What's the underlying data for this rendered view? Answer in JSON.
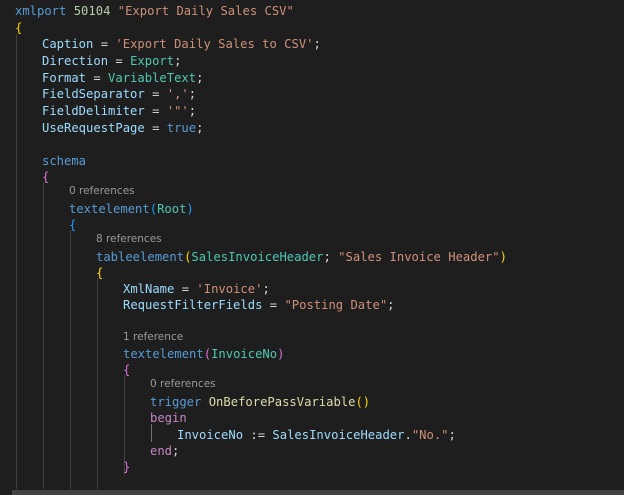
{
  "code": {
    "line_xmlport": {
      "keyword": "xmlport",
      "id": "50104",
      "name": "\"Export Daily Sales CSV\""
    },
    "open_brace_root": "{",
    "caption": {
      "prop": "Caption",
      "eq": " = ",
      "value": "'Export Daily Sales to CSV'",
      "end": ";"
    },
    "direction": {
      "prop": "Direction",
      "eq": " = ",
      "value": "Export",
      "end": ";"
    },
    "format": {
      "prop": "Format",
      "eq": " = ",
      "value": "VariableText",
      "end": ";"
    },
    "field_separator": {
      "prop": "FieldSeparator",
      "eq": " = ",
      "value": "','",
      "end": ";"
    },
    "field_delimiter": {
      "prop": "FieldDelimiter",
      "eq": " = ",
      "value": "'\"'",
      "end": ";"
    },
    "use_request_page": {
      "prop": "UseRequestPage",
      "eq": " = ",
      "value": "true",
      "end": ";"
    },
    "schema": {
      "keyword": "schema",
      "brace": "{"
    },
    "lens_root": "0 references",
    "textelement_root": {
      "keyword": "textelement",
      "open": "(",
      "name": "Root",
      "close": ")",
      "brace": "{"
    },
    "lens_table": "8 references",
    "tableelement": {
      "keyword": "tableelement",
      "open": "(",
      "name": "SalesInvoiceHeader",
      "sep": "; ",
      "table": "\"Sales Invoice Header\"",
      "close": ")",
      "brace": "{"
    },
    "xmlname": {
      "prop": "XmlName",
      "eq": " = ",
      "value": "'Invoice'",
      "end": ";"
    },
    "request_filter": {
      "prop": "RequestFilterFields",
      "eq": " = ",
      "value": "\"Posting Date\"",
      "end": ";"
    },
    "lens_invoice": "1 reference",
    "textelement_invoice": {
      "keyword": "textelement",
      "open": "(",
      "name": "InvoiceNo",
      "close": ")",
      "brace": "{"
    },
    "lens_trigger": "0 references",
    "trigger": {
      "keyword": "trigger",
      "name": "OnBeforePassVariable",
      "parens": "()"
    },
    "begin": "begin",
    "assign": {
      "var": "InvoiceNo",
      "op": " := ",
      "rec": "SalesInvoiceHeader",
      "dot": ".",
      "field": "\"No.\"",
      "end": ";"
    },
    "end": {
      "keyword": "end",
      "semi": ";"
    },
    "close_brace_invoice": "}"
  },
  "colors": {
    "background": "#1e1e1e",
    "keyword": "#569cd6",
    "control": "#c586c0",
    "number": "#b5cea8",
    "string": "#ce9178",
    "property": "#9cdcfe",
    "function": "#dcdcaa",
    "type": "#4ec9b0",
    "codelens": "#999999",
    "bracket_gold": "#ffd700",
    "bracket_purple": "#da70d6",
    "bracket_blue": "#179fff"
  }
}
